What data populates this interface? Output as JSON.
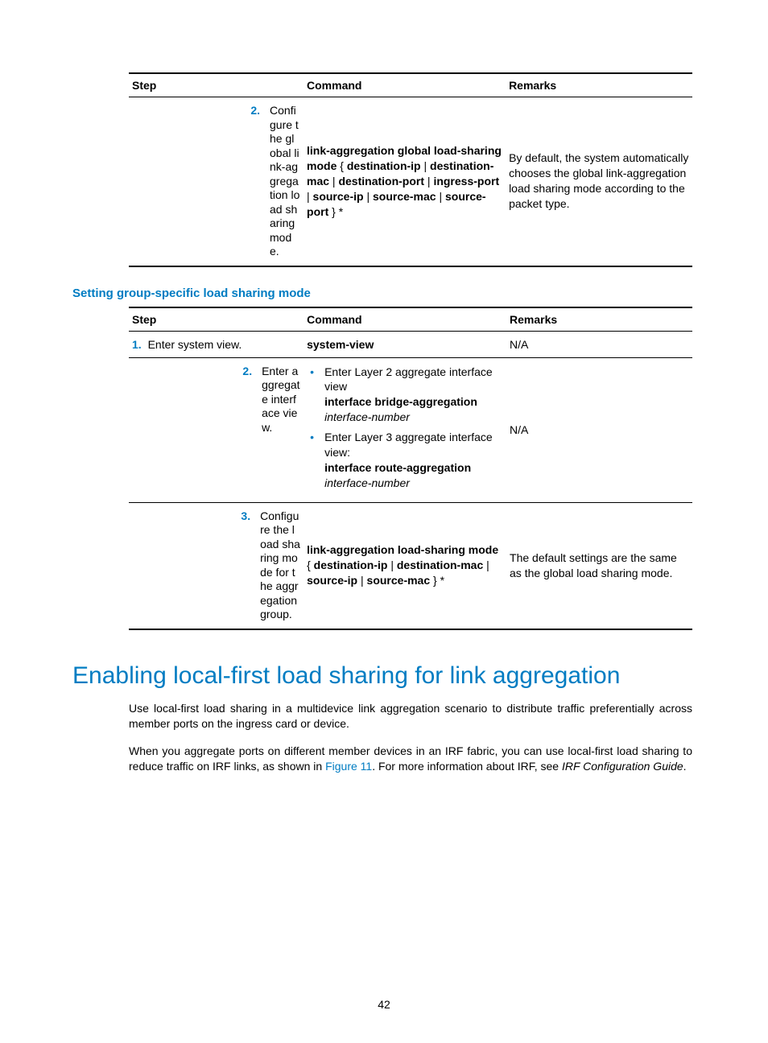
{
  "table1": {
    "headers": {
      "step": "Step",
      "command": "Command",
      "remarks": "Remarks"
    },
    "row2": {
      "num": "2.",
      "label": "Configure the global link-aggregation load sharing mode.",
      "cmd_lead": "link-aggregation global load-sharing mode",
      "cmd_rest1": " { ",
      "cmd_o1": "destination-ip",
      "cmd_sep": " | ",
      "cmd_o2": "destination-mac",
      "cmd_o3": "destination-port",
      "cmd_o4": "ingress-port",
      "cmd_o5": "source-ip",
      "cmd_o6": "source-mac",
      "cmd_o7": "source-port",
      "cmd_close": " } *",
      "remarks": "By default, the system automatically chooses the global link-aggregation load sharing mode according to the packet type."
    }
  },
  "subheading1": "Setting group-specific load sharing mode",
  "table2": {
    "headers": {
      "step": "Step",
      "command": "Command",
      "remarks": "Remarks"
    },
    "row1": {
      "num": "1.",
      "label": "Enter system view.",
      "cmd": "system-view",
      "remarks": "N/A"
    },
    "row2": {
      "num": "2.",
      "label": "Enter aggregate interface view.",
      "bullet1_pre": "Enter Layer 2 aggregate interface view",
      "bullet1_cmd": "interface bridge-aggregation",
      "bullet1_arg": "interface-number",
      "bullet2_pre": "Enter Layer 3 aggregate interface view:",
      "bullet2_cmd": "interface route-aggregation",
      "bullet2_arg": "interface-number",
      "remarks": "N/A"
    },
    "row3": {
      "num": "3.",
      "label": "Configure the load sharing mode for the aggregation group.",
      "cmd_lead": "link-aggregation load-sharing mode",
      "cmd_o1": "destination-ip",
      "cmd_o2": "destination-mac",
      "cmd_o3": "source-ip",
      "cmd_o4": "source-mac",
      "cmd_close": " } *",
      "remarks": "The default settings are the same as the global load sharing mode."
    }
  },
  "section_title": "Enabling local-first load sharing for link aggregation",
  "para1": "Use local-first load sharing in a multidevice link aggregation scenario to distribute traffic preferentially across member ports on the ingress card or device.",
  "para2_a": "When you aggregate ports on different member devices in an IRF fabric, you can use local-first load sharing to reduce traffic on IRF links, as shown in ",
  "para2_link": "Figure 11",
  "para2_b": ". For more information about IRF, see ",
  "para2_italic": "IRF Configuration Guide",
  "para2_c": ".",
  "pagenum": "42"
}
